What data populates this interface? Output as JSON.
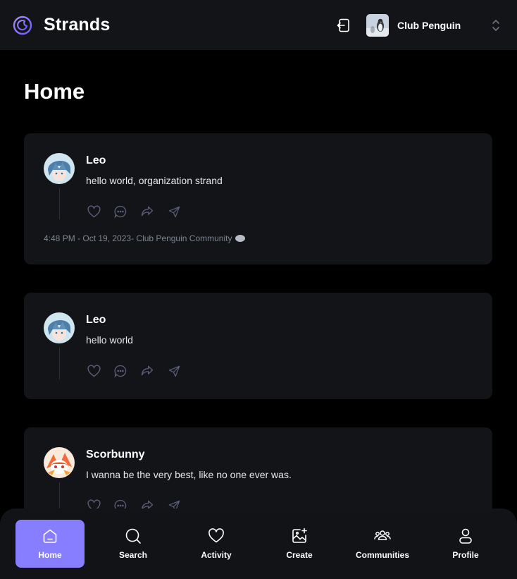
{
  "app": {
    "name": "Strands",
    "logo_icon": "strands-logo-icon",
    "accent": "#877eff"
  },
  "topbar": {
    "logout_icon": "logout-icon",
    "org": {
      "name": "Club Penguin",
      "chevron_icon": "chevron-updown-icon"
    }
  },
  "page": {
    "title": "Home"
  },
  "posts": [
    {
      "author": "Leo",
      "text": "hello world, organization strand",
      "meta": "4:48 PM - Oct 19, 2023- Club Penguin Community",
      "actions": [
        "heart-icon",
        "reply-icon",
        "repost-icon",
        "share-icon"
      ]
    },
    {
      "author": "Leo",
      "text": "hello world",
      "actions": [
        "heart-icon",
        "reply-icon",
        "repost-icon",
        "share-icon"
      ]
    },
    {
      "author": "Scorbunny",
      "text": "I wanna be the very best, like no one ever was.",
      "actions": [
        "heart-icon",
        "reply-icon",
        "repost-icon",
        "share-icon"
      ]
    }
  ],
  "bottom_nav": [
    {
      "label": "Home",
      "icon": "home-icon",
      "active": true
    },
    {
      "label": "Search",
      "icon": "search-icon"
    },
    {
      "label": "Activity",
      "icon": "heart-icon"
    },
    {
      "label": "Create",
      "icon": "create-icon"
    },
    {
      "label": "Communities",
      "icon": "communities-icon"
    },
    {
      "label": "Profile",
      "icon": "profile-icon"
    }
  ]
}
